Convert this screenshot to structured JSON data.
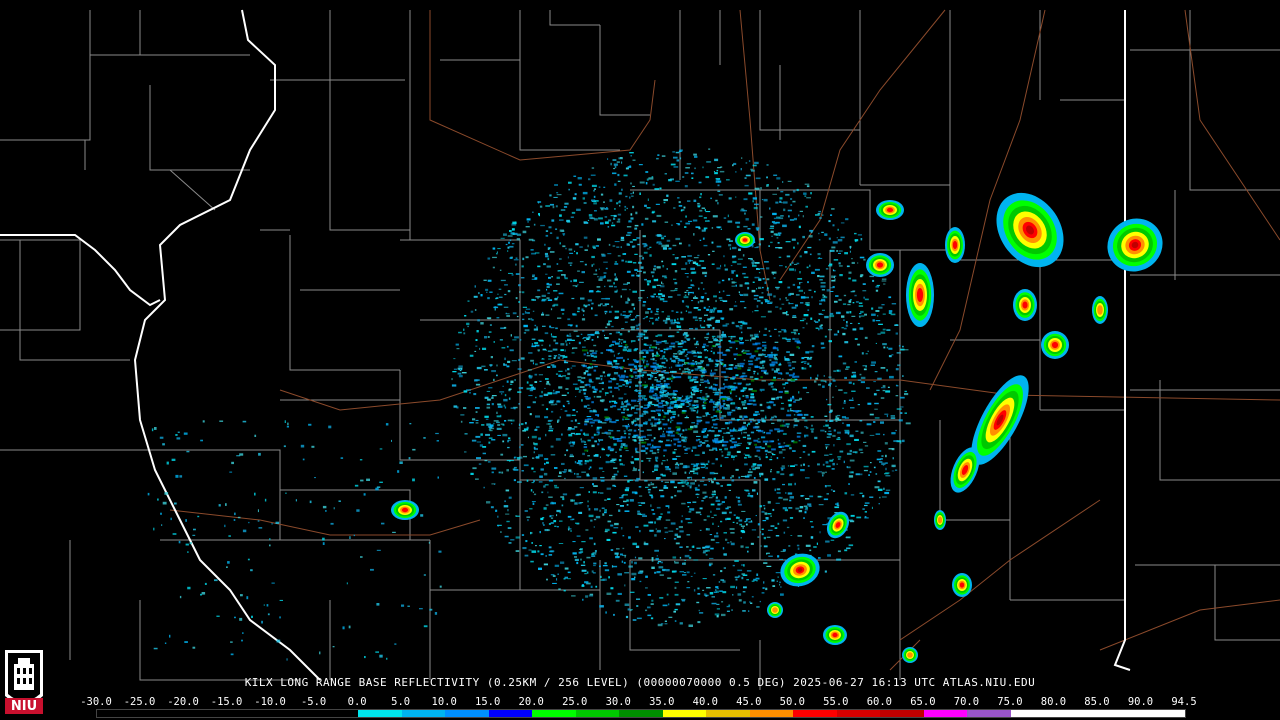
{
  "product": {
    "caption": "KILX LONG RANGE BASE REFLECTIVITY (0.25KM / 256 LEVEL) (00000070000 0.5 DEG) 2025-06-27 16:13 UTC  ATLAS.NIU.EDU"
  },
  "logo": {
    "text": "NIU",
    "icon": "niu-tower-icon",
    "color": "#c8102e"
  },
  "color_scale": {
    "labels": [
      "-30.0",
      "-25.0",
      "-20.0",
      "-15.0",
      "-10.0",
      "-5.0",
      "0.0",
      "5.0",
      "10.0",
      "15.0",
      "20.0",
      "25.0",
      "30.0",
      "35.0",
      "40.0",
      "45.0",
      "50.0",
      "55.0",
      "60.0",
      "65.0",
      "70.0",
      "75.0",
      "80.0",
      "85.0",
      "90.0",
      "94.5"
    ],
    "colors": [
      "#000000",
      "#000000",
      "#000000",
      "#000000",
      "#000000",
      "#000000",
      "#00e5ee",
      "#00b4f0",
      "#0090ff",
      "#0000ff",
      "#00ff00",
      "#00c800",
      "#009000",
      "#ffff00",
      "#e7c000",
      "#ff9000",
      "#ff0000",
      "#d60000",
      "#c00000",
      "#ff00ff",
      "#9955c9",
      "#ffffff",
      "#ffffff",
      "#ffffff",
      "#ffffff"
    ]
  },
  "map_style": {
    "background": "#000000",
    "county_lines": "#8a8a8a",
    "state_lines": "#ffffff",
    "highways": "#8b4a2b"
  }
}
